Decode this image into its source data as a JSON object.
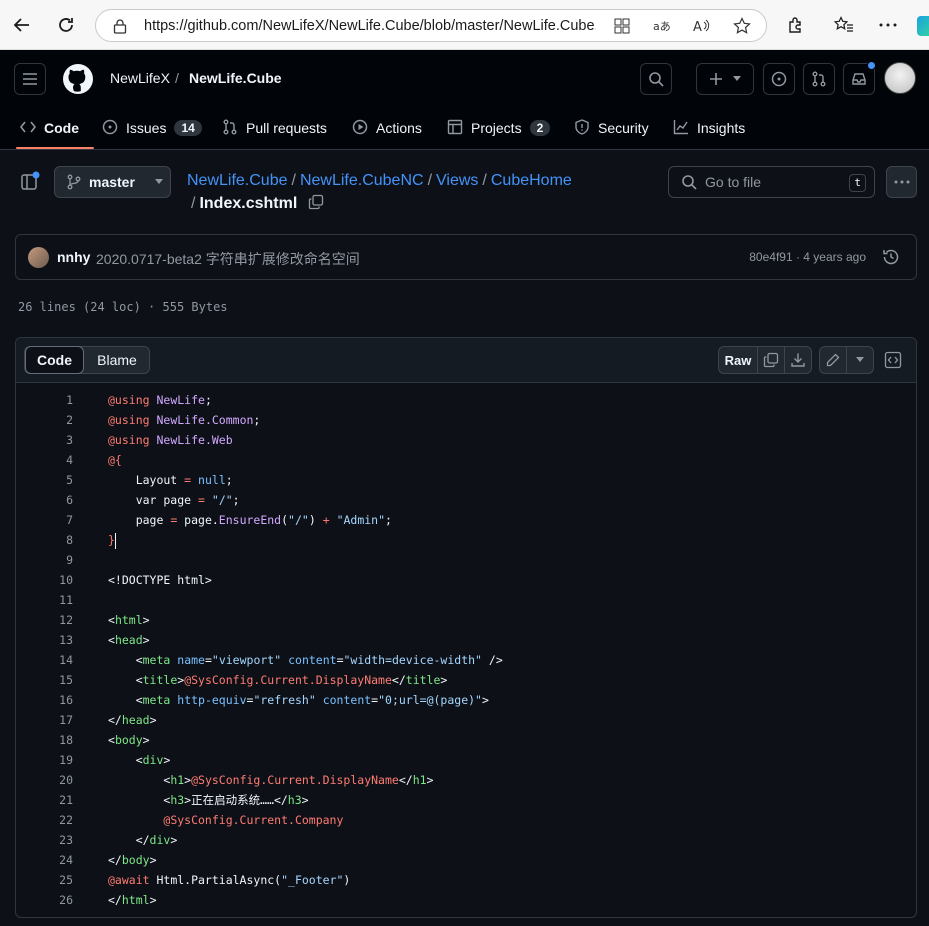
{
  "browser": {
    "url": "https://github.com/NewLifeX/NewLife.Cube/blob/master/NewLife.Cube...",
    "back_icon": "arrow-left-icon",
    "reload_icon": "reload-icon"
  },
  "header": {
    "owner": "NewLifeX",
    "separator": "/",
    "repo": "NewLife.Cube"
  },
  "tabs": [
    {
      "label": "Code",
      "icon": "code-icon"
    },
    {
      "label": "Issues",
      "icon": "issue-icon",
      "count": "14"
    },
    {
      "label": "Pull requests",
      "icon": "pull-request-icon"
    },
    {
      "label": "Actions",
      "icon": "play-icon"
    },
    {
      "label": "Projects",
      "icon": "table-icon",
      "count": "2"
    },
    {
      "label": "Security",
      "icon": "shield-icon"
    },
    {
      "label": "Insights",
      "icon": "graph-icon"
    }
  ],
  "file_nav": {
    "branch": "master",
    "crumbs": [
      "NewLife.Cube",
      "NewLife.CubeNC",
      "Views",
      "CubeHome"
    ],
    "filename": "Index.cshtml",
    "goto_placeholder": "Go to file",
    "goto_shortcut": "t"
  },
  "commit": {
    "author": "nnhy",
    "message": "2020.0717-beta2 字符串扩展修改命名空间",
    "meta": "80e4f91 · 4 years ago"
  },
  "file_info": "26 lines (24 loc) · 555 Bytes",
  "code_toolbar": {
    "code_tab": "Code",
    "blame_tab": "Blame",
    "raw_label": "Raw"
  },
  "code_lines": [
    "1",
    "2",
    "3",
    "4",
    "5",
    "6",
    "7",
    "8",
    "9",
    "10",
    "11",
    "12",
    "13",
    "14",
    "15",
    "16",
    "17",
    "18",
    "19",
    "20",
    "21",
    "22",
    "23",
    "24",
    "25",
    "26"
  ],
  "colors": {
    "keyword": "#ff7b72",
    "string": "#a5d6ff",
    "tag": "#7ee787",
    "attribute": "#79c0ff",
    "accent_underline": "#f78166",
    "link": "#4493f8"
  }
}
